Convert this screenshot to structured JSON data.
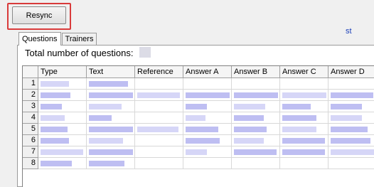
{
  "toolbar": {
    "resync_label": "Resync"
  },
  "tabs": [
    {
      "label": "Questions",
      "active": true
    },
    {
      "label": "Trainers",
      "active": false
    }
  ],
  "summary": {
    "total_label": "Total number of questions:"
  },
  "grid": {
    "columns": [
      "Type",
      "Text",
      "Reference",
      "Answer A",
      "Answer B",
      "Answer C",
      "Answer D"
    ],
    "row_numbers": [
      "1",
      "2",
      "3",
      "4",
      "5",
      "6",
      "7",
      "8"
    ],
    "overflow_fragment": "st"
  },
  "colors": {
    "highlight": "#d93b3b",
    "redacted": "#b3b3f0"
  }
}
